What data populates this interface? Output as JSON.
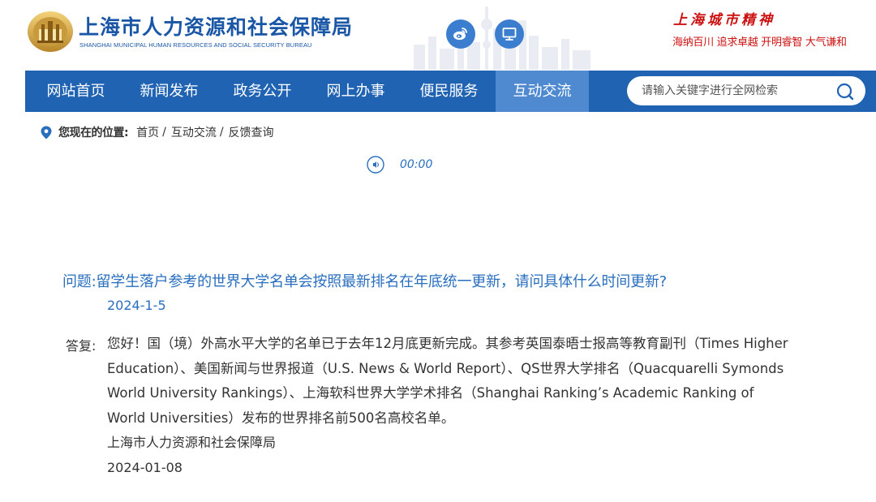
{
  "header": {
    "logo_title": "上海市人力资源和社会保障局",
    "logo_subtitle": "SHANGHAI MUNICIPAL HUMAN RESOURCES AND SOCIAL SECURITY BUREAU",
    "weibo_icon": "weibo-icon",
    "mobile_icon": "computer-monitor-icon",
    "city_spirit_title": "上海城市精神",
    "city_spirit_slogan": "海纳百川 追求卓越 开明睿智 大气谦和"
  },
  "nav": {
    "items": [
      {
        "label": "网站首页",
        "active": false
      },
      {
        "label": "新闻发布",
        "active": false
      },
      {
        "label": "政务公开",
        "active": false
      },
      {
        "label": "网上办事",
        "active": false
      },
      {
        "label": "便民服务",
        "active": false
      },
      {
        "label": "互动交流",
        "active": true
      }
    ],
    "search_placeholder": "请输入关键字进行全网检索",
    "search_icon": "search-icon"
  },
  "breadcrumb": {
    "icon": "location-pin-icon",
    "label": "您现在的位置:",
    "items": [
      "首页",
      "互动交流",
      "反馈查询"
    ],
    "separator": "/"
  },
  "audio": {
    "icon": "audio-play-icon",
    "time": "00:00"
  },
  "qa": {
    "question_label": "问题:",
    "question_text": "留学生落户参考的世界大学名单会按照最新排名在年底统一更新，请问具体什么时间更新?",
    "question_date": "2024-1-5",
    "answer_label": "答复:",
    "answer_text": "您好！国（境）外高水平大学的名单已于去年12月底更新完成。其参考英国泰晤士报高等教育副刊（Times Higher Education）、美国新闻与世界报道（U.S. News & World Report）、QS世界大学排名（Quacquarelli Symonds World University Rankings）、上海软科世界大学学术排名（Shanghai Ranking’s Academic Ranking of World Universities）发布的世界排名前500名高校名单。",
    "answer_signature": "上海市人力资源和社会保障局",
    "answer_date": "2024-01-08"
  },
  "colors": {
    "brand_blue": "#2063b3",
    "active_tab": "#4f8ad0",
    "link_blue": "#2a6fbf",
    "slogan_red": "#cc1111"
  }
}
